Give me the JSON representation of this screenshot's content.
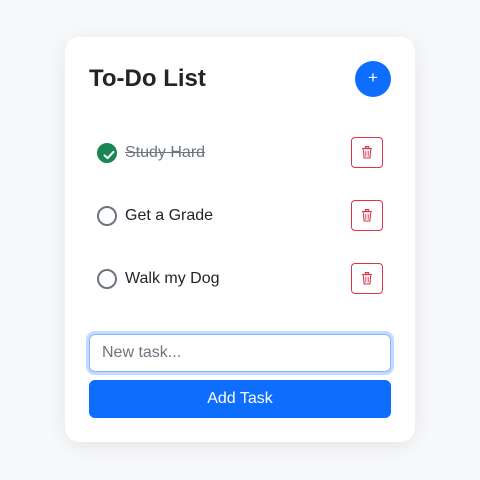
{
  "header": {
    "title": "To-Do List",
    "add_icon_label": "+"
  },
  "tasks": [
    {
      "label": "Study Hard",
      "completed": true
    },
    {
      "label": "Get a Grade",
      "completed": false
    },
    {
      "label": "Walk my Dog",
      "completed": false
    }
  ],
  "new_task": {
    "placeholder": "New task...",
    "value": "",
    "submit_label": "Add Task"
  },
  "icons": {
    "add": "plus-icon",
    "check": "check-icon",
    "delete": "trash-icon"
  },
  "colors": {
    "primary": "#0d6efd",
    "success": "#198754",
    "danger": "#dc3545",
    "text": "#212529",
    "muted": "#6c757d"
  }
}
